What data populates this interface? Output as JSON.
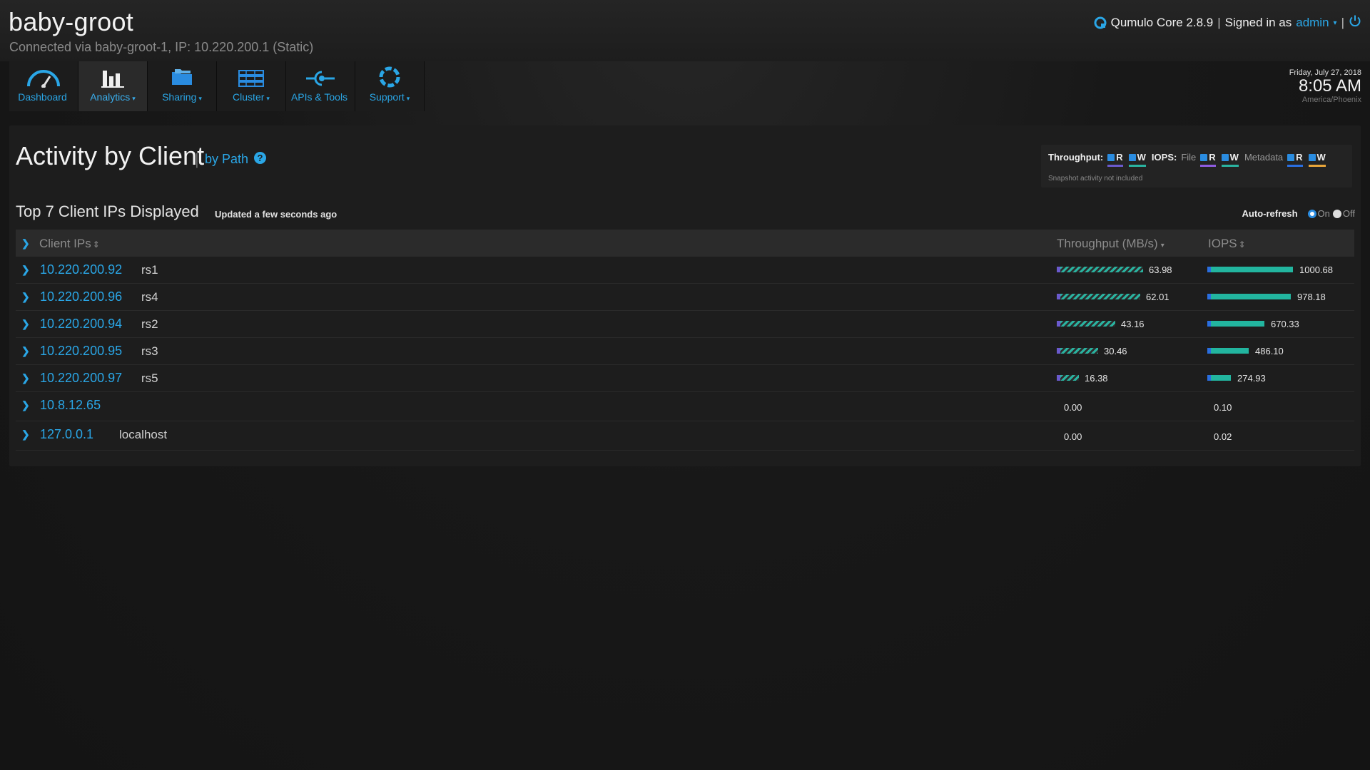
{
  "header": {
    "cluster_name": "baby-groot",
    "connection": "Connected via baby-groot-1, IP: 10.220.200.1 (Static)",
    "product": "Qumulo Core 2.8.9",
    "signed_in_label": "Signed in as",
    "user": "admin",
    "user_caret": "▾",
    "separator": "|"
  },
  "nav": {
    "items": [
      {
        "label": "Dashboard",
        "icon": "dashboard-gauge-icon",
        "caret": ""
      },
      {
        "label": "Analytics",
        "icon": "analytics-bar-chart-icon",
        "caret": "▾"
      },
      {
        "label": "Sharing",
        "icon": "sharing-folder-icon",
        "caret": "▾"
      },
      {
        "label": "Cluster",
        "icon": "cluster-servers-icon",
        "caret": "▾"
      },
      {
        "label": "APIs & Tools",
        "icon": "api-plug-icon",
        "caret": ""
      },
      {
        "label": "Support",
        "icon": "support-lifebuoy-icon",
        "caret": "▾"
      }
    ],
    "active": "Analytics"
  },
  "datetime": {
    "date": "Friday, July 27, 2018",
    "time": "8:05 AM",
    "timezone": "America/Phoenix"
  },
  "page": {
    "title": "Activity by Client",
    "separator": "|",
    "by_path_link": "by Path",
    "help_icon": "?",
    "subtitle": "Top 7 Client IPs Displayed",
    "updated": "Updated a few seconds ago"
  },
  "legend": {
    "throughput_label": "Throughput:",
    "iops_label": "IOPS:",
    "file_label": "File",
    "metadata_label": "Metadata",
    "read": "R",
    "write": "W",
    "snapshot_note": "Snapshot activity not included",
    "colors": {
      "throughput_read": "#6a5acd",
      "throughput_write": "#2ab3a0",
      "file_read": "#8e5ce0",
      "file_write": "#2ab3a0",
      "metadata_read": "#2a6ee0",
      "metadata_write": "#e8a53a"
    }
  },
  "autorefresh": {
    "label": "Auto-refresh",
    "on": "On",
    "off": "Off",
    "selected": "On"
  },
  "table": {
    "columns": {
      "client": "Client IPs",
      "client_sort": "⇕",
      "throughput": "Throughput (MB/s)",
      "throughput_sort": "▾",
      "iops": "IOPS",
      "iops_sort": "⇕"
    },
    "rows": [
      {
        "ip": "10.220.200.92",
        "host": "rs1",
        "throughput": "63.98",
        "iops": "1000.68"
      },
      {
        "ip": "10.220.200.96",
        "host": "rs4",
        "throughput": "62.01",
        "iops": "978.18"
      },
      {
        "ip": "10.220.200.94",
        "host": "rs2",
        "throughput": "43.16",
        "iops": "670.33"
      },
      {
        "ip": "10.220.200.95",
        "host": "rs3",
        "throughput": "30.46",
        "iops": "486.10"
      },
      {
        "ip": "10.220.200.97",
        "host": "rs5",
        "throughput": "16.38",
        "iops": "274.93"
      },
      {
        "ip": "10.8.12.65",
        "host": "",
        "throughput": "0.00",
        "iops": "0.10"
      },
      {
        "ip": "127.0.0.1",
        "host": "localhost",
        "throughput": "0.00",
        "iops": "0.02"
      }
    ],
    "max_throughput": 63.98,
    "max_iops": 1000.68
  },
  "colors": {
    "accent": "#2aa6e6",
    "bar_teal": "#22b59f"
  }
}
